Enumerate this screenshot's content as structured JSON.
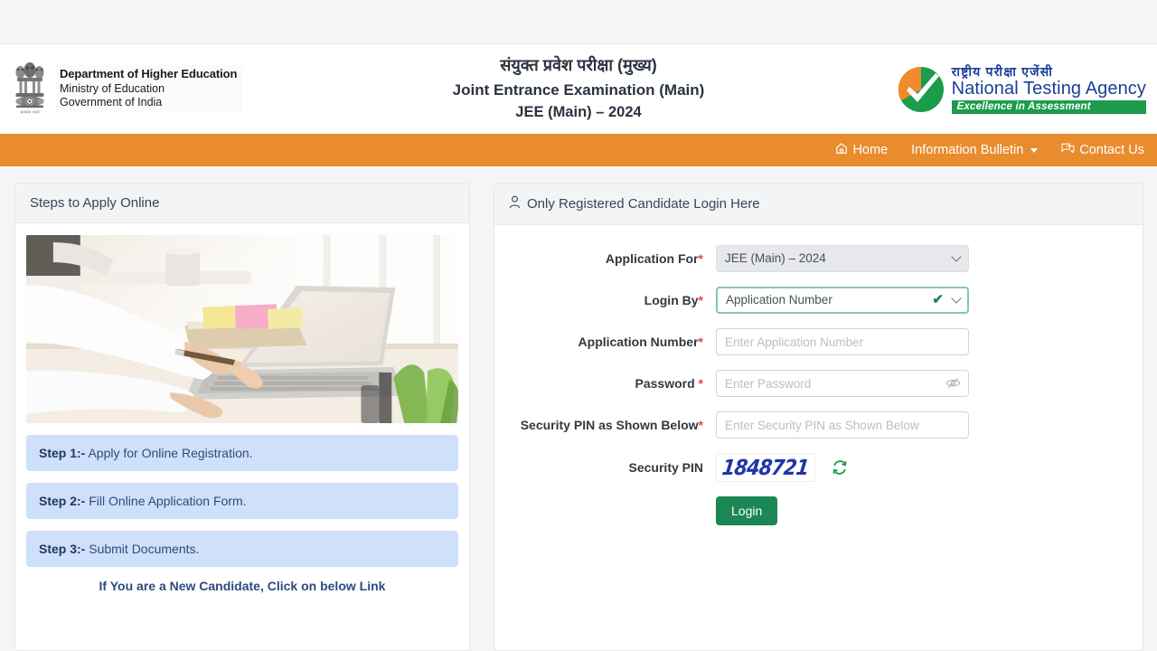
{
  "header": {
    "left_emblem_icon": "india-state-emblem-icon",
    "left_line1": "Department of Higher Education",
    "left_line2": "Ministry of Education",
    "left_line3": "Government of India",
    "center_hindi": "संयुक्त प्रवेश परीक्षा (मुख्य)",
    "center_english": "Joint Entrance Examination (Main)",
    "center_exam": "JEE (Main) – 2024",
    "nta_logo_icon": "nta-tick-logo-icon",
    "nta_hindi": "राष्ट्रीय परीक्षा एजेंसी",
    "nta_english": "National Testing Agency",
    "nta_tagline": "Excellence in Assessment"
  },
  "nav": {
    "bg_color": "#e98c2e",
    "items": [
      {
        "label": "Home",
        "icon": "home-icon",
        "has_caret": false
      },
      {
        "label": "Information Bulletin",
        "icon": "",
        "has_caret": true
      },
      {
        "label": "Contact Us",
        "icon": "chat-icon",
        "has_caret": false
      }
    ]
  },
  "left_panel": {
    "title": "Steps to Apply Online",
    "image_alt": "person-typing-on-laptop-photo",
    "steps": [
      {
        "prefix": "Step 1:-",
        "text": " Apply for Online Registration."
      },
      {
        "prefix": "Step 2:-",
        "text": " Fill Online Application Form."
      },
      {
        "prefix": "Step 3:-",
        "text": " Submit Documents."
      }
    ],
    "note": "If You are a New Candidate, Click on below Link"
  },
  "login_panel": {
    "title": "Only Registered Candidate Login Here",
    "title_icon": "user-icon",
    "fields": {
      "application_for": {
        "label": "Application For",
        "required": true,
        "value": "JEE (Main) – 2024",
        "disabled": true,
        "options": [
          "JEE (Main) – 2024"
        ]
      },
      "login_by": {
        "label": "Login By",
        "required": true,
        "value": "Application Number",
        "valid": true,
        "options": [
          "Application Number"
        ]
      },
      "application_number": {
        "label": "Application Number",
        "required": true,
        "value": "",
        "placeholder": "Enter Application Number"
      },
      "password": {
        "label": "Password ",
        "required": true,
        "value": "",
        "placeholder": "Enter Password",
        "toggle_icon": "eye-slash-icon"
      },
      "security_pin_input": {
        "label": "Security PIN as Shown Below",
        "required": true,
        "value": "",
        "placeholder": "Enter Security PIN as Shown Below"
      },
      "security_pin_captcha": {
        "label": "Security PIN",
        "value": "1848721",
        "refresh_icon": "refresh-icon"
      }
    },
    "submit_label": "Login",
    "submit_color": "#1a8754"
  }
}
